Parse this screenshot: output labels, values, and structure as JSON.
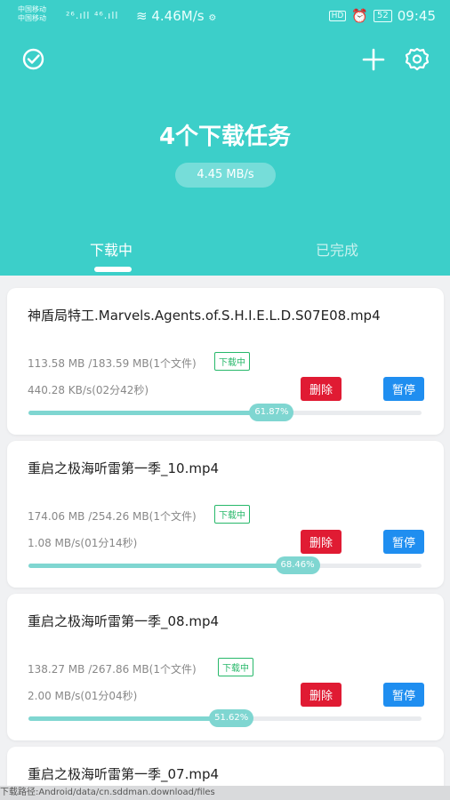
{
  "status_bar": {
    "carrier1": "中国移动",
    "carrier2": "中国移动",
    "signal_icons": "²⁶.ıll ⁴⁶.ıll",
    "speed": "4.46M/s",
    "battery": "52",
    "time": "09:45"
  },
  "header": {
    "title": "4个下载任务",
    "speed": "4.45 MB/s",
    "tabs": [
      {
        "label": "下载中"
      },
      {
        "label": "已完成"
      }
    ]
  },
  "downloads": [
    {
      "name": "神盾局特工.Marvels.Agents.of.S.H.I.E.L.D.S07E08.mp4",
      "size": "113.58 MB /183.59 MB(1个文件)",
      "status": "下载中",
      "rate": "440.28 KB/s(02分42秒)",
      "delete_label": "删除",
      "pause_label": "暂停",
      "progress": 61.87,
      "progress_label": "61.87%"
    },
    {
      "name": "重启之极海听雷第一季_10.mp4",
      "size": "174.06 MB /254.26 MB(1个文件)",
      "status": "下载中",
      "rate": "1.08 MB/s(01分14秒)",
      "delete_label": "删除",
      "pause_label": "暂停",
      "progress": 68.46,
      "progress_label": "68.46%"
    },
    {
      "name": "重启之极海听雷第一季_08.mp4",
      "size": "138.27 MB /267.86 MB(1个文件)",
      "status": "下载中",
      "rate": "2.00 MB/s(01分04秒)",
      "delete_label": "删除",
      "pause_label": "暂停",
      "progress": 51.62,
      "progress_label": "51.62%"
    },
    {
      "name": "重启之极海听雷第一季_07.mp4"
    }
  ],
  "download_path": "下载路径:Android/data/cn.sddman.download/files",
  "colors": {
    "accent": "#3ccfc9",
    "delete": "#e01b33",
    "pause": "#1f8ef0",
    "status": "#27b86a"
  }
}
